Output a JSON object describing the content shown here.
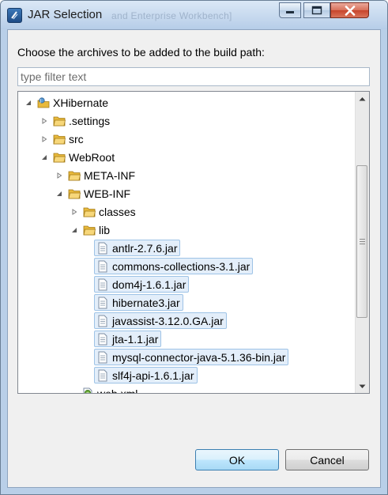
{
  "window": {
    "title": "JAR Selection",
    "faint_background_title": "and Enterprise Workbench]"
  },
  "dialog": {
    "prompt": "Choose the archives to be added to the build path:",
    "filter": {
      "placeholder": "type filter text",
      "value": ""
    }
  },
  "tree": {
    "project": "XHibernate",
    "settings": ".settings",
    "src": "src",
    "webroot": "WebRoot",
    "meta_inf": "META-INF",
    "web_inf": "WEB-INF",
    "classes": "classes",
    "lib": "lib",
    "jars": [
      "antlr-2.7.6.jar",
      "commons-collections-3.1.jar",
      "dom4j-1.6.1.jar",
      "hibernate3.jar",
      "javassist-3.12.0.GA.jar",
      "jta-1.1.jar",
      "mysql-connector-java-5.1.36-bin.jar",
      "slf4j-api-1.6.1.jar"
    ],
    "web_xml": "web.xml"
  },
  "buttons": {
    "ok": "OK",
    "cancel": "Cancel"
  },
  "colors": {
    "folder": "#e8b93c",
    "selection_border": "#9ec3e6",
    "selection_fill": "#e3eefa",
    "title_bar": "#b9cfe8"
  },
  "icons": {
    "app": "eclipse-dialog-icon",
    "project": "java-project-icon",
    "folder": "folder-icon",
    "file": "jar-file-icon",
    "xml": "xml-file-icon"
  }
}
